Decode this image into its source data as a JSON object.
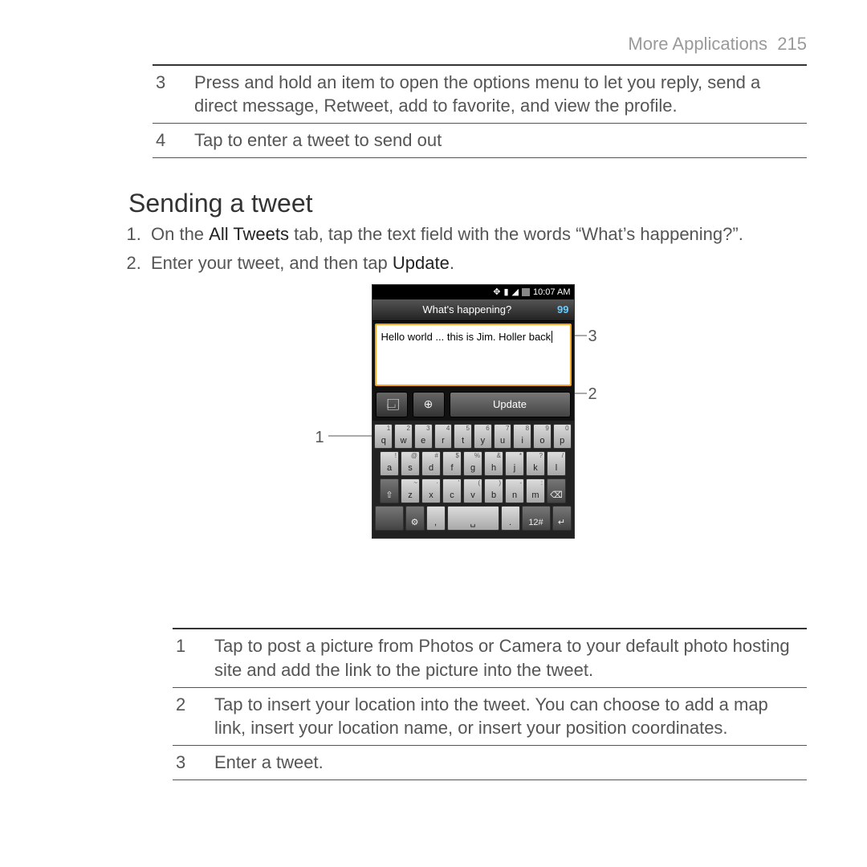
{
  "header": {
    "section": "More Applications",
    "page": "215"
  },
  "top_callouts": [
    {
      "n": "3",
      "text": "Press and hold an item to open the options menu to let you reply, send a direct message, Retweet, add to favorite, and view the profile."
    },
    {
      "n": "4",
      "text": "Tap to enter a tweet to send out"
    }
  ],
  "heading": "Sending a tweet",
  "steps": {
    "s1_pre": "On the ",
    "s1_bold": "All Tweets",
    "s1_post": " tab, tap the text field with the words “What’s happening?”.",
    "s2_pre": "Enter your tweet, and then tap ",
    "s2_bold": "Update",
    "s2_post": "."
  },
  "phone": {
    "time": "10:07 AM",
    "title": "What's happening?",
    "count": "99",
    "text": "Hello world ... this is Jim. Holler back",
    "update": "Update",
    "krow1_sup": [
      "1",
      "2",
      "3",
      "4",
      "5",
      "6",
      "7",
      "8",
      "9",
      "0"
    ],
    "krow1": [
      "q",
      "w",
      "e",
      "r",
      "t",
      "y",
      "u",
      "i",
      "o",
      "p"
    ],
    "krow2_sup": [
      "!",
      "@",
      "#",
      "$",
      "%",
      "&",
      "*",
      "?",
      "/"
    ],
    "krow2": [
      "a",
      "s",
      "d",
      "f",
      "g",
      "h",
      "j",
      "k",
      "l"
    ],
    "krow3_sup": [
      "~",
      "·",
      "'",
      "(",
      ")",
      "-",
      ":"
    ],
    "krow3": [
      "z",
      "x",
      "c",
      "v",
      "b",
      "n",
      "m"
    ],
    "k12": "12#"
  },
  "ann": {
    "a1": "1",
    "a2": "2",
    "a3": "3"
  },
  "bottom_callouts": [
    {
      "n": "1",
      "text": "Tap to post a picture from Photos or Camera to your default photo hosting site and add the link to the picture into the tweet."
    },
    {
      "n": "2",
      "text": "Tap to insert your location into the tweet. You can choose to add a map link, insert your location name, or insert your position coordinates."
    },
    {
      "n": "3",
      "text": "Enter a tweet."
    }
  ]
}
